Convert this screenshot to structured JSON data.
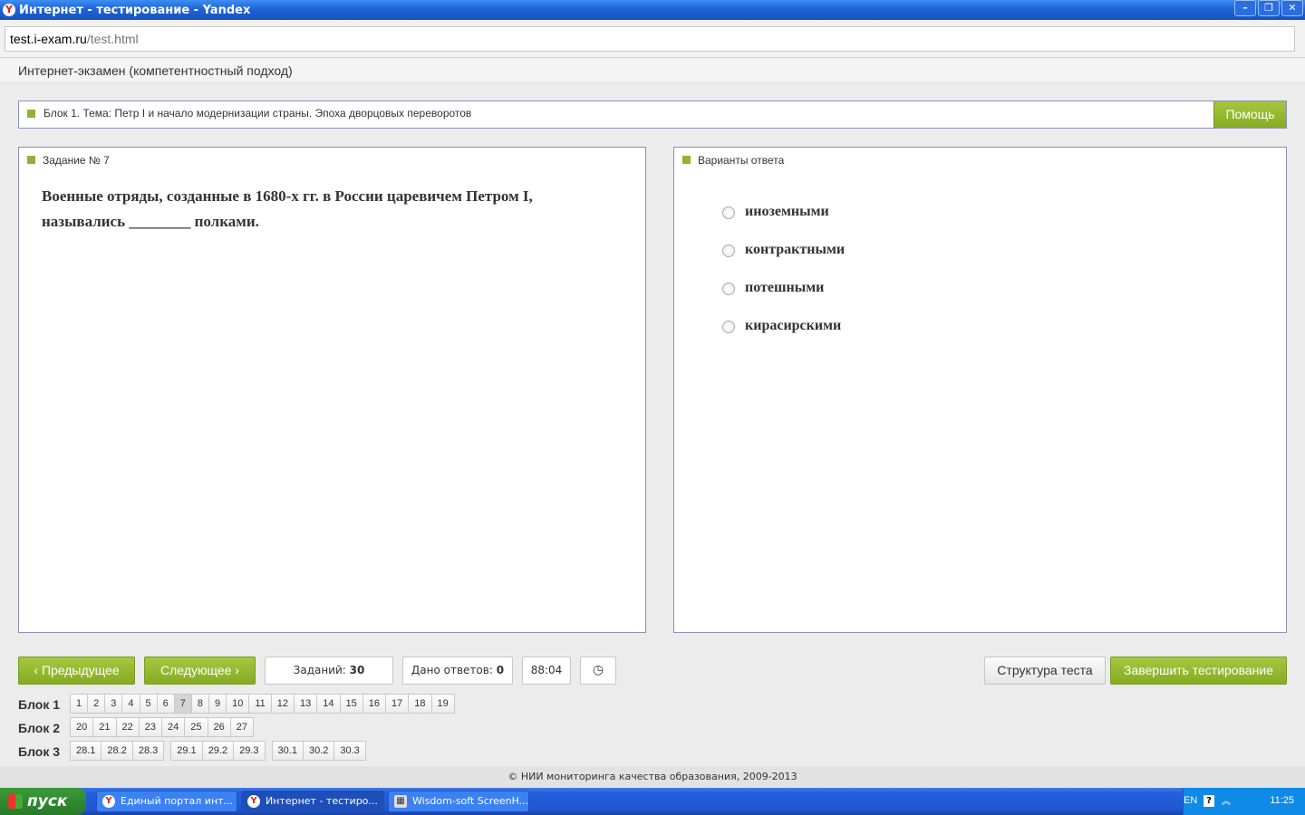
{
  "window": {
    "title": "Интернет - тестирование - Yandex"
  },
  "address": {
    "host": "test.i-exam.ru",
    "path": "/test.html"
  },
  "page": {
    "header": "Интернет-экзамен (компетентностный подход)"
  },
  "topic": {
    "text": "Блок 1. Тема: Петр I и начало модернизации страны. Эпоха дворцовых переворотов",
    "help_label": "Помощь"
  },
  "task": {
    "title": "Задание № 7",
    "question": "Военные отряды, созданные в 1680-х гг. в России царевичем Петром I, назывались ________ полками."
  },
  "answers": {
    "title": "Варианты ответа",
    "options": [
      "иноземными",
      "контрактными",
      "потешными",
      "кирасирскими"
    ]
  },
  "controls": {
    "prev_label": "Предыдущее",
    "next_label": "Следующее",
    "tasks_label": "Заданий:",
    "tasks_count": "30",
    "answered_label": "Дано ответов:",
    "answered_count": "0",
    "timer": "88:04",
    "structure_label": "Структура теста",
    "finish_label": "Завершить тестирование"
  },
  "blocks": [
    {
      "label": "Блок 1",
      "groups": [
        [
          "1",
          "2",
          "3",
          "4",
          "5",
          "6",
          "7",
          "8",
          "9",
          "10",
          "11",
          "12",
          "13",
          "14",
          "15",
          "16",
          "17",
          "18",
          "19"
        ]
      ]
    },
    {
      "label": "Блок 2",
      "groups": [
        [
          "20",
          "21",
          "22",
          "23",
          "24",
          "25",
          "26",
          "27"
        ]
      ]
    },
    {
      "label": "Блок 3",
      "groups": [
        [
          "28.1",
          "28.2",
          "28.3"
        ],
        [
          "29.1",
          "29.2",
          "29.3"
        ],
        [
          "30.1",
          "30.2",
          "30.3"
        ]
      ]
    }
  ],
  "current_task": "7",
  "footer": "© НИИ мониторинга качества образования, 2009-2013",
  "taskbar": {
    "start_label": "пуск",
    "items": [
      "Единый портал инт...",
      "Интернет - тестиро...",
      "Wisdom-soft ScreenH..."
    ],
    "lang": "EN",
    "clock": "11:25"
  },
  "colors": {
    "accent_green": "#8fb431",
    "panel_border": "#8b8fbb",
    "titlebar_blue": "#1e64d8"
  }
}
